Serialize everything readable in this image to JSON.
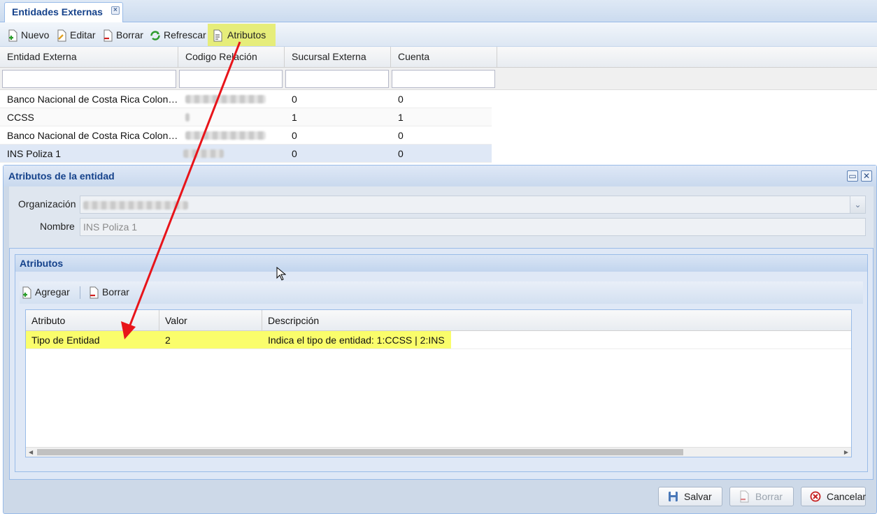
{
  "tab": {
    "title": "Entidades Externas"
  },
  "toolbar": {
    "nuevo": "Nuevo",
    "editar": "Editar",
    "borrar": "Borrar",
    "refrescar": "Refrescar",
    "atributos": "Atributos"
  },
  "grid": {
    "columns": [
      "Entidad Externa",
      "Codigo Relación",
      "Sucursal Externa",
      "Cuenta"
    ],
    "rows": [
      {
        "entidad": "Banco Nacional de Costa Rica Colon…",
        "sucursal": "0",
        "cuenta": "0"
      },
      {
        "entidad": "CCSS",
        "sucursal": "1",
        "cuenta": "1"
      },
      {
        "entidad": "Banco Nacional de Costa Rica Colon…",
        "sucursal": "0",
        "cuenta": "0"
      },
      {
        "entidad": "INS Poliza 1",
        "sucursal": "0",
        "cuenta": "0"
      }
    ]
  },
  "window": {
    "title": "Atributos de la entidad",
    "organizacion_label": "Organización",
    "nombre_label": "Nombre",
    "nombre_value": "INS Poliza 1",
    "atributos_title": "Atributos",
    "agregar": "Agregar",
    "borrar": "Borrar",
    "attr_columns": [
      "Atributo",
      "Valor",
      "Descripción"
    ],
    "attr_rows": [
      {
        "atributo": "Tipo de Entidad",
        "valor": "2",
        "descripcion": "Indica el tipo de entidad: 1:CCSS | 2:INS"
      }
    ],
    "salvar": "Salvar",
    "borrar_btn": "Borrar",
    "cancelar": "Cancelar"
  },
  "colors": {
    "highlight": "#fafd6b",
    "annotation_arrow": "#e8141a",
    "header_text": "#15428b"
  }
}
